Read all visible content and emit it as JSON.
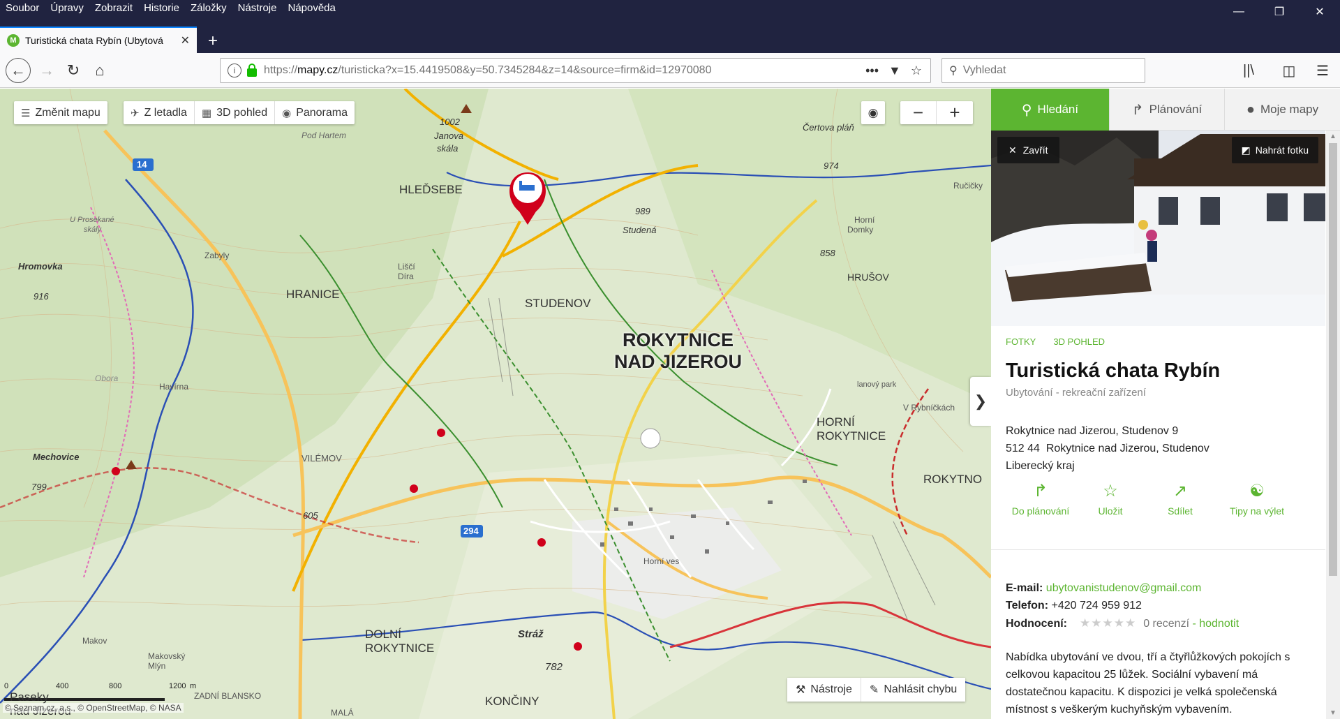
{
  "menubar": {
    "items": [
      "Soubor",
      "Úpravy",
      "Zobrazit",
      "Historie",
      "Záložky",
      "Nástroje",
      "Nápověda"
    ]
  },
  "tab": {
    "title": "Turistická chata Rybín (Ubytová",
    "favicon": "M"
  },
  "urlbar": {
    "scheme": "https://",
    "host": "mapy.cz",
    "path": "/turisticka?x=15.4419508&y=50.7345284&z=14&source=firm&id=12970080"
  },
  "search": {
    "placeholder": "Vyhledat"
  },
  "map": {
    "controls": {
      "change_map": "Změnit mapu",
      "aerial": "Z letadla",
      "view_3d": "3D pohled",
      "panorama": "Panorama"
    },
    "zoom_out": "−",
    "zoom_in": "+",
    "town": [
      "ROKYTNICE",
      "NAD JIZEROU"
    ],
    "places": [
      {
        "label": "HLEĎSEBE"
      },
      {
        "label": "HRANICE"
      },
      {
        "label": "STUDENOV"
      },
      {
        "label": "HRUŠOV"
      },
      {
        "label": "HORNÍ"
      },
      {
        "label": "ROKYTNICE"
      },
      {
        "label": "ROKYTNO"
      },
      {
        "label": "DOLNÍ"
      },
      {
        "label": "ROKYTNICE"
      },
      {
        "label": "KONČINY"
      },
      {
        "label": "VILÉMOV"
      },
      {
        "label": "Horní ves"
      },
      {
        "label": "Studená"
      },
      {
        "label": "989"
      },
      {
        "label": "858"
      },
      {
        "label": "974"
      },
      {
        "label": "Čertova pláň"
      },
      {
        "label": "1002"
      },
      {
        "label": "Janova"
      },
      {
        "label": "skála"
      },
      {
        "label": "Pod Hartem"
      },
      {
        "label": "Hromovka"
      },
      {
        "label": "916"
      },
      {
        "label": "Zabyly"
      },
      {
        "label": "Havírna"
      },
      {
        "label": "Mechovice"
      },
      {
        "label": "799"
      },
      {
        "label": "605"
      },
      {
        "label": "Stráž"
      },
      {
        "label": "782"
      },
      {
        "label": "Makov"
      },
      {
        "label": "Makovský"
      },
      {
        "label": "Mlýn"
      },
      {
        "label": "Liščí"
      },
      {
        "label": "Díra"
      },
      {
        "label": "Horní"
      },
      {
        "label": "Domky"
      },
      {
        "label": "lanový park"
      },
      {
        "label": "V Rybníčkách"
      },
      {
        "label": "Ručičky"
      },
      {
        "label": "U Prosekané"
      },
      {
        "label": "skály"
      },
      {
        "label": "Obora"
      },
      {
        "label": "ZADNÍ BLANSKO"
      },
      {
        "label": "MALÁ"
      },
      {
        "label": "Paseky"
      },
      {
        "label": "nad Jizerou"
      }
    ],
    "road_numbers": [
      "14",
      "294"
    ],
    "scale_labels": [
      "0",
      "400",
      "800",
      "1200",
      "m"
    ],
    "copyright": "© Seznam.cz, a.s., © OpenStreetMap, © NASA",
    "tools": "Nástroje",
    "report": "Nahlásit chybu",
    "panel_toggle": "❯"
  },
  "panel": {
    "tabs": {
      "search": "Hledání",
      "planning": "Plánování",
      "my_maps": "Moje mapy"
    },
    "photo_close": "Zavřít",
    "photo_upload": "Nahrát fotku",
    "links": {
      "photos": "Fotky",
      "view_3d": "3D pohled"
    },
    "title": "Turistická chata Rybín",
    "subtitle": "Ubytování - rekreační zařízení",
    "address": {
      "line1": "Rokytnice nad Jizerou, Studenov 9",
      "line2": "512 44  Rokytnice nad Jizerou, Studenov",
      "line3": "Liberecký kraj"
    },
    "actions": {
      "plan": "Do plánování",
      "save": "Uložit",
      "share": "Sdílet",
      "trip": "Tipy na výlet"
    },
    "contacts": {
      "email_label": "E-mail:",
      "email": "ubytovanistudenov@gmail.com",
      "phone_label": "Telefon:",
      "phone": "+420 724 959 912",
      "rating_label": "Hodnocení:",
      "rating_stars": 0,
      "reviews": "0 recenzí",
      "dash": " - ",
      "rate": "hodnotit"
    },
    "description": "Nabídka ubytování ve dvou, tří a čtyřlůžkových pokojích s celkovou kapacitou 25 lůžek. Sociální vybavení má dostatečnou kapacitu. K dispozici je velká společenská místnost s veškerým kuchyňským vybavením."
  },
  "colors": {
    "brand_green": "#5cb531",
    "chrome_dark": "#202340",
    "marker_red": "#d0001b"
  }
}
